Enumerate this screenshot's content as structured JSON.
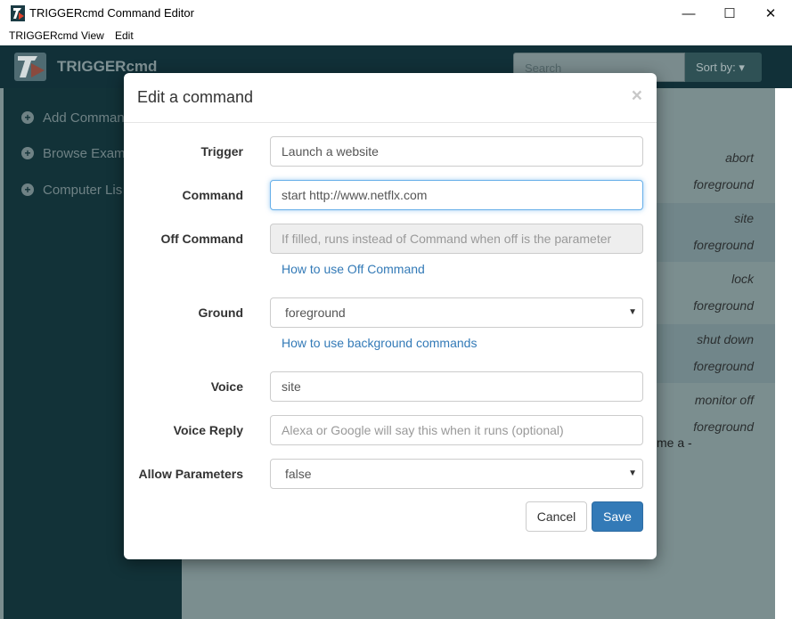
{
  "window": {
    "title": "TRIGGERcmd Command Editor",
    "minimize_glyph": "—",
    "maximize_glyph": "☐",
    "close_glyph": "✕"
  },
  "menubar": {
    "items": [
      "TRIGGERcmd",
      "View",
      "Edit"
    ]
  },
  "navbar": {
    "brand": "TRIGGERcmd",
    "search_placeholder": "Search",
    "sort_label": "Sort by: ▾"
  },
  "sidebar": {
    "items": [
      {
        "label": "Add Comman",
        "icon": "plus-circle-icon"
      },
      {
        "label": "Browse Exam",
        "icon": "plus-circle-icon"
      },
      {
        "label": "Computer Lis",
        "icon": "plus-circle-icon"
      }
    ]
  },
  "background_rows": [
    {
      "trigger": "abort",
      "ground": "foreground"
    },
    {
      "trigger": "site",
      "ground": "foreground"
    },
    {
      "trigger": "lock",
      "ground": "foreground"
    },
    {
      "trigger": "shut down",
      "ground": "foreground"
    },
    {
      "trigger": "monitor off",
      "ground": "foreground"
    }
  ],
  "background_trailing_text": "me a -",
  "modal": {
    "title": "Edit a command",
    "close_glyph": "×",
    "fields": {
      "trigger": {
        "label": "Trigger",
        "value": "Launch a website"
      },
      "command": {
        "label": "Command",
        "value": "start http://www.netflx.com"
      },
      "off_command": {
        "label": "Off Command",
        "placeholder": "If filled, runs instead of Command when off is the parameter"
      },
      "ground": {
        "label": "Ground",
        "value": "foreground"
      },
      "voice": {
        "label": "Voice",
        "value": "site"
      },
      "voice_reply": {
        "label": "Voice Reply",
        "placeholder": "Alexa or Google will say this when it runs (optional)"
      },
      "allow_parameters": {
        "label": "Allow Parameters",
        "value": "false"
      }
    },
    "links": {
      "off_command_help": "How to use Off Command",
      "background_help": "How to use background commands"
    },
    "buttons": {
      "cancel": "Cancel",
      "save": "Save"
    }
  },
  "colors": {
    "primary": "#337ab7",
    "navbar": "#113038",
    "focus": "#66afe9"
  }
}
